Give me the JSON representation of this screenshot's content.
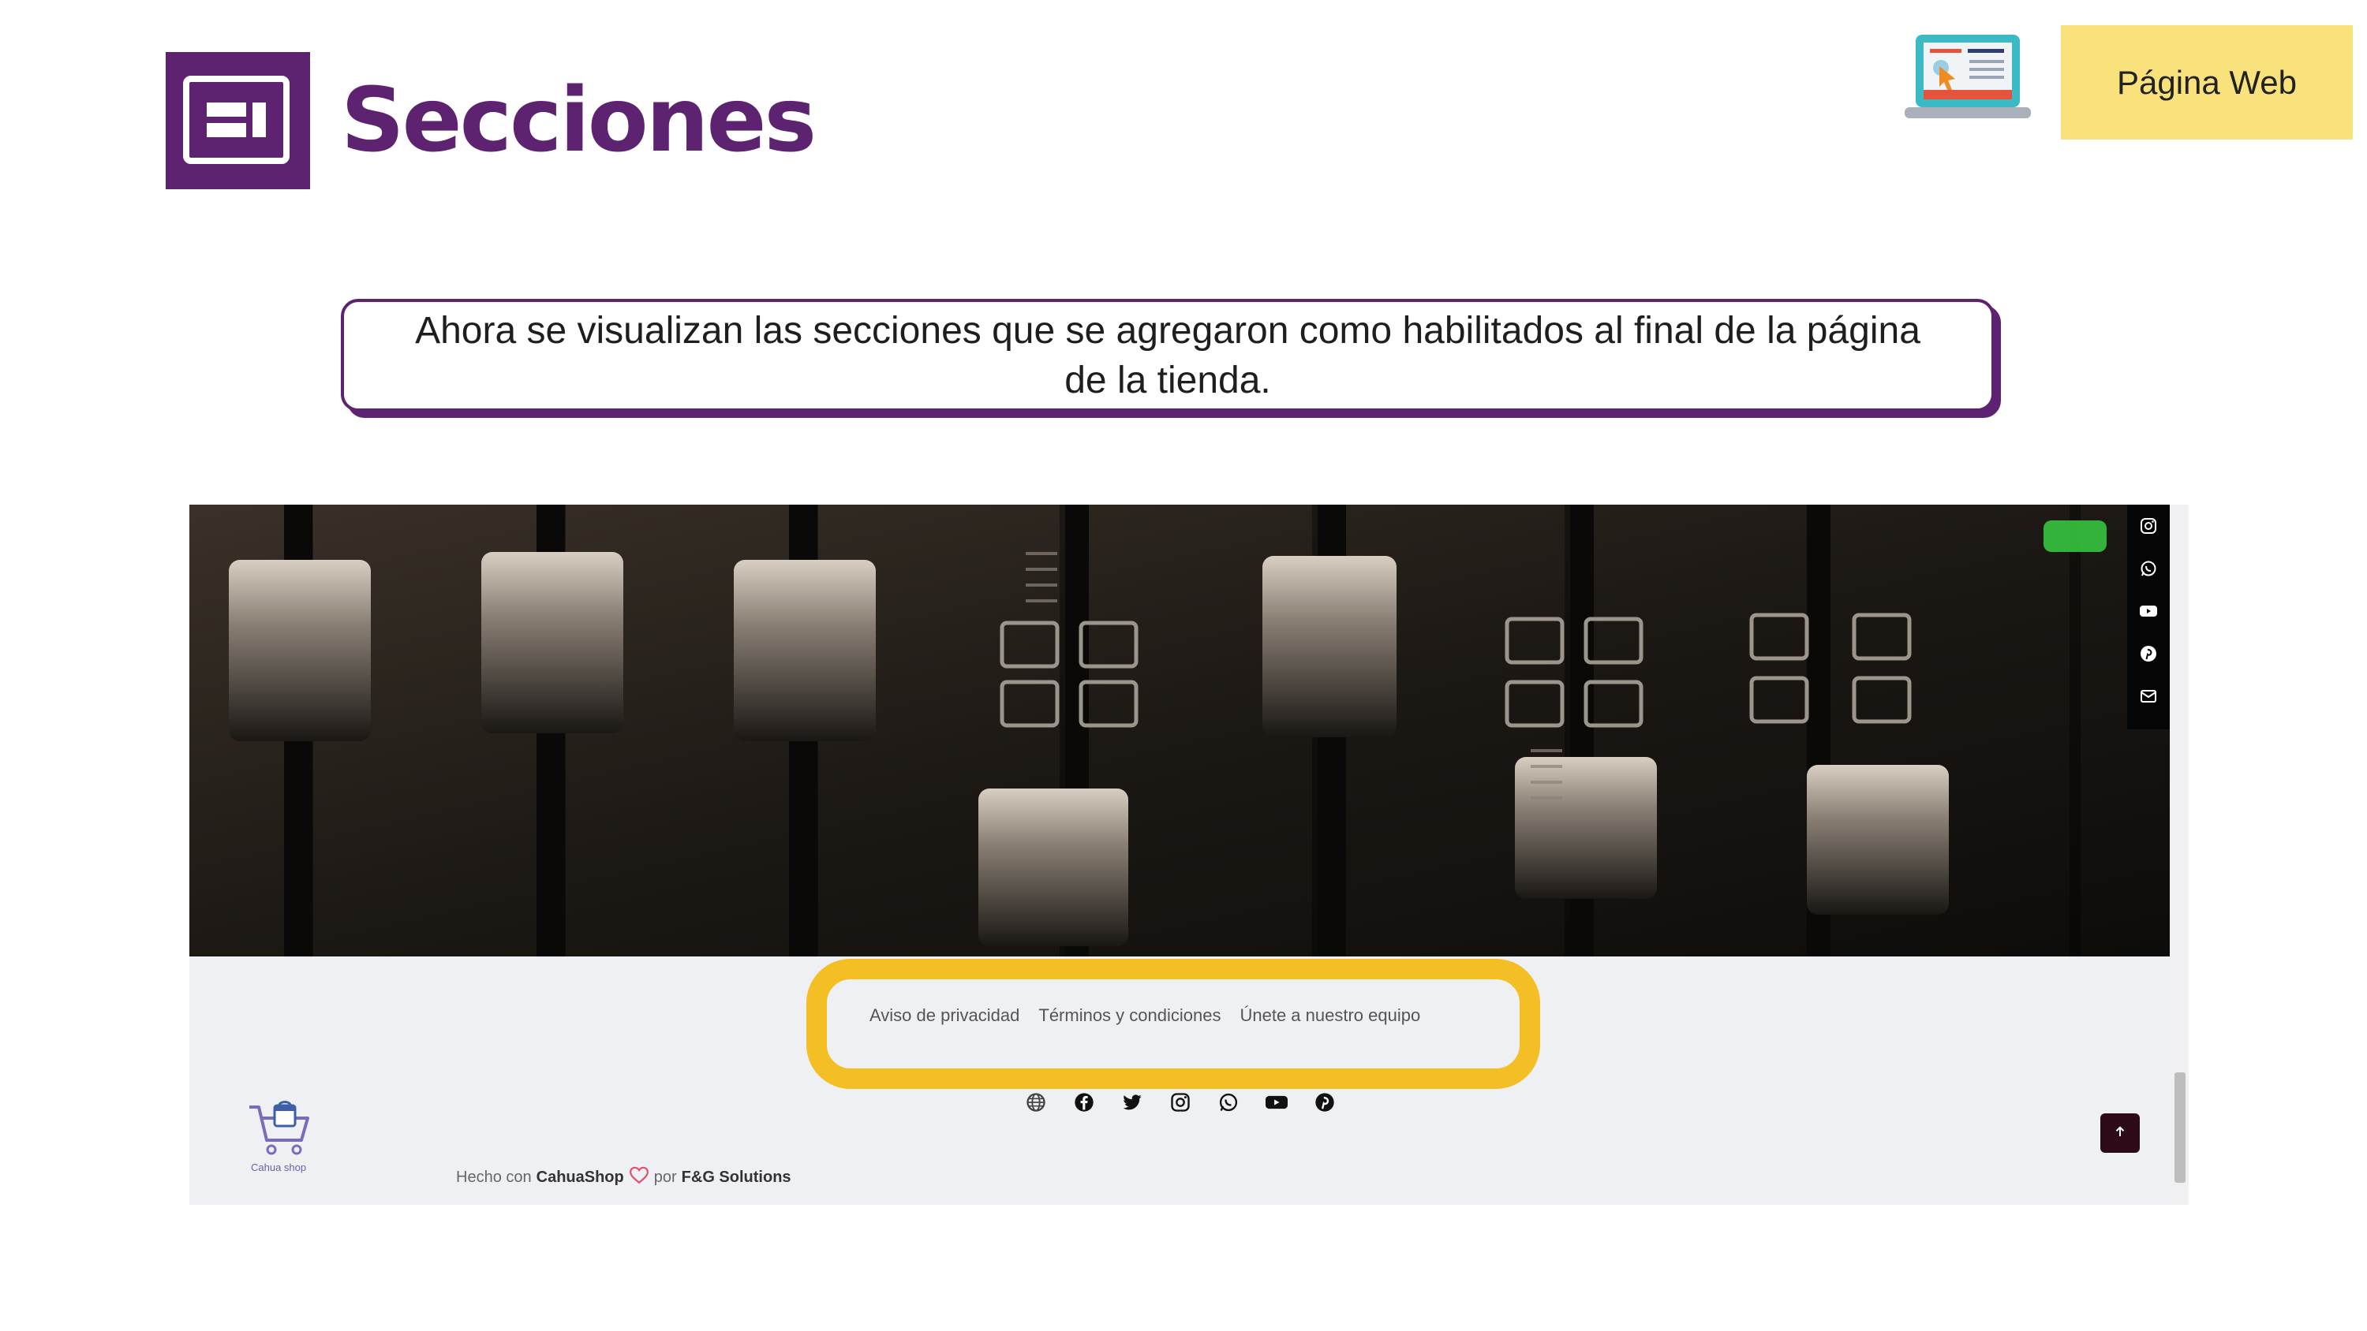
{
  "header": {
    "title": "Secciones",
    "logo_icon": "sections-layout-icon",
    "badge_label": "Página Web",
    "badge_icon": "laptop-web-icon"
  },
  "callout": {
    "text": "Ahora se visualizan las secciones que se agregaron como habilitados al final de la página de la tienda."
  },
  "store": {
    "hero_image": "audio-mixer-faders-photo",
    "side_social_icons": [
      "instagram-icon",
      "whatsapp-icon",
      "youtube-icon",
      "pinterest-icon",
      "email-icon"
    ],
    "footer_links": [
      "Aviso de privacidad",
      "Términos y condiciones",
      "Únete a nuestro equipo"
    ],
    "footer_social_icons": [
      "globe-icon",
      "facebook-icon",
      "twitter-icon",
      "instagram-icon",
      "whatsapp-icon",
      "youtube-icon",
      "pinterest-icon"
    ],
    "brand_caption": "Cahua shop",
    "made_with_prefix": "Hecho con",
    "made_with_brand": "CahuaShop",
    "made_with_by": "por",
    "made_with_company": "F&G Solutions",
    "scroll_top_icon": "arrow-up-icon"
  },
  "colors": {
    "brand_purple": "#5e2370",
    "badge_yellow": "#f9e27c",
    "highlight_yellow": "#f3bf25"
  }
}
